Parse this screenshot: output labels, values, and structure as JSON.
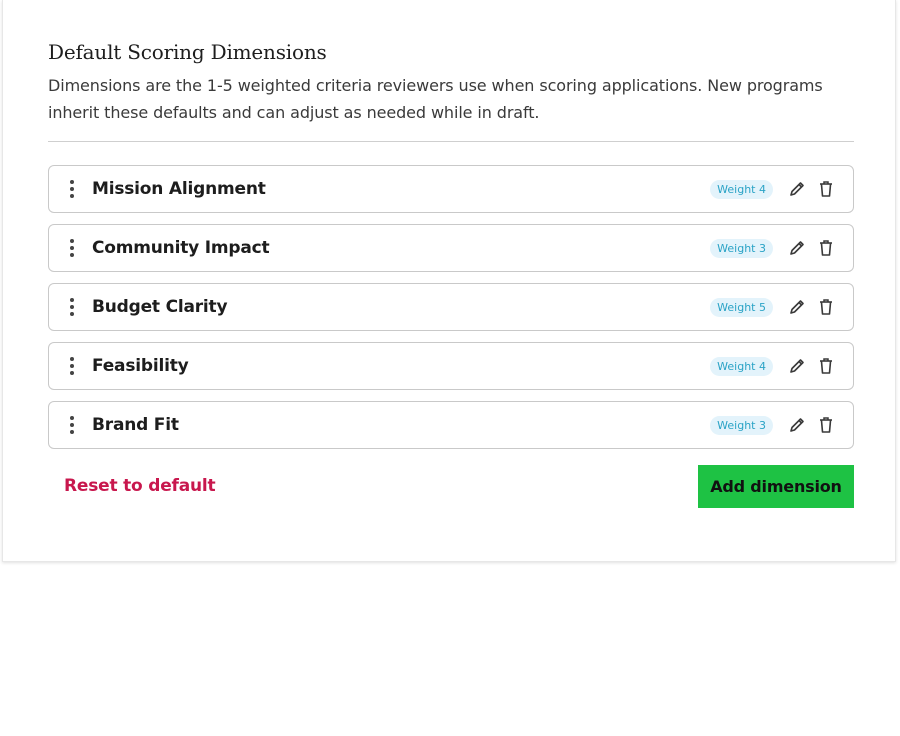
{
  "section": {
    "title": "Default Scoring Dimensions",
    "description": "Dimensions are the 1-5 weighted criteria reviewers use when scoring applications. New programs inherit these defaults and can adjust as needed while in draft."
  },
  "dimensions": [
    {
      "label": "Mission Alignment",
      "weight_label": "Weight 4",
      "weight": 4
    },
    {
      "label": "Community Impact",
      "weight_label": "Weight 3",
      "weight": 3
    },
    {
      "label": "Budget Clarity",
      "weight_label": "Weight 5",
      "weight": 5
    },
    {
      "label": "Feasibility",
      "weight_label": "Weight 4",
      "weight": 4
    },
    {
      "label": "Brand Fit",
      "weight_label": "Weight 3",
      "weight": 3
    }
  ],
  "actions": {
    "reset_label": "Reset to default",
    "add_label": "Add dimension"
  },
  "icons": {
    "drag": "drag-handle-icon",
    "edit": "pencil-icon",
    "delete": "trash-icon"
  },
  "colors": {
    "accent_green": "#1ec244",
    "reset_red": "#c8174d",
    "badge_bg": "#e3f3fb",
    "badge_text": "#2aa3c6"
  }
}
